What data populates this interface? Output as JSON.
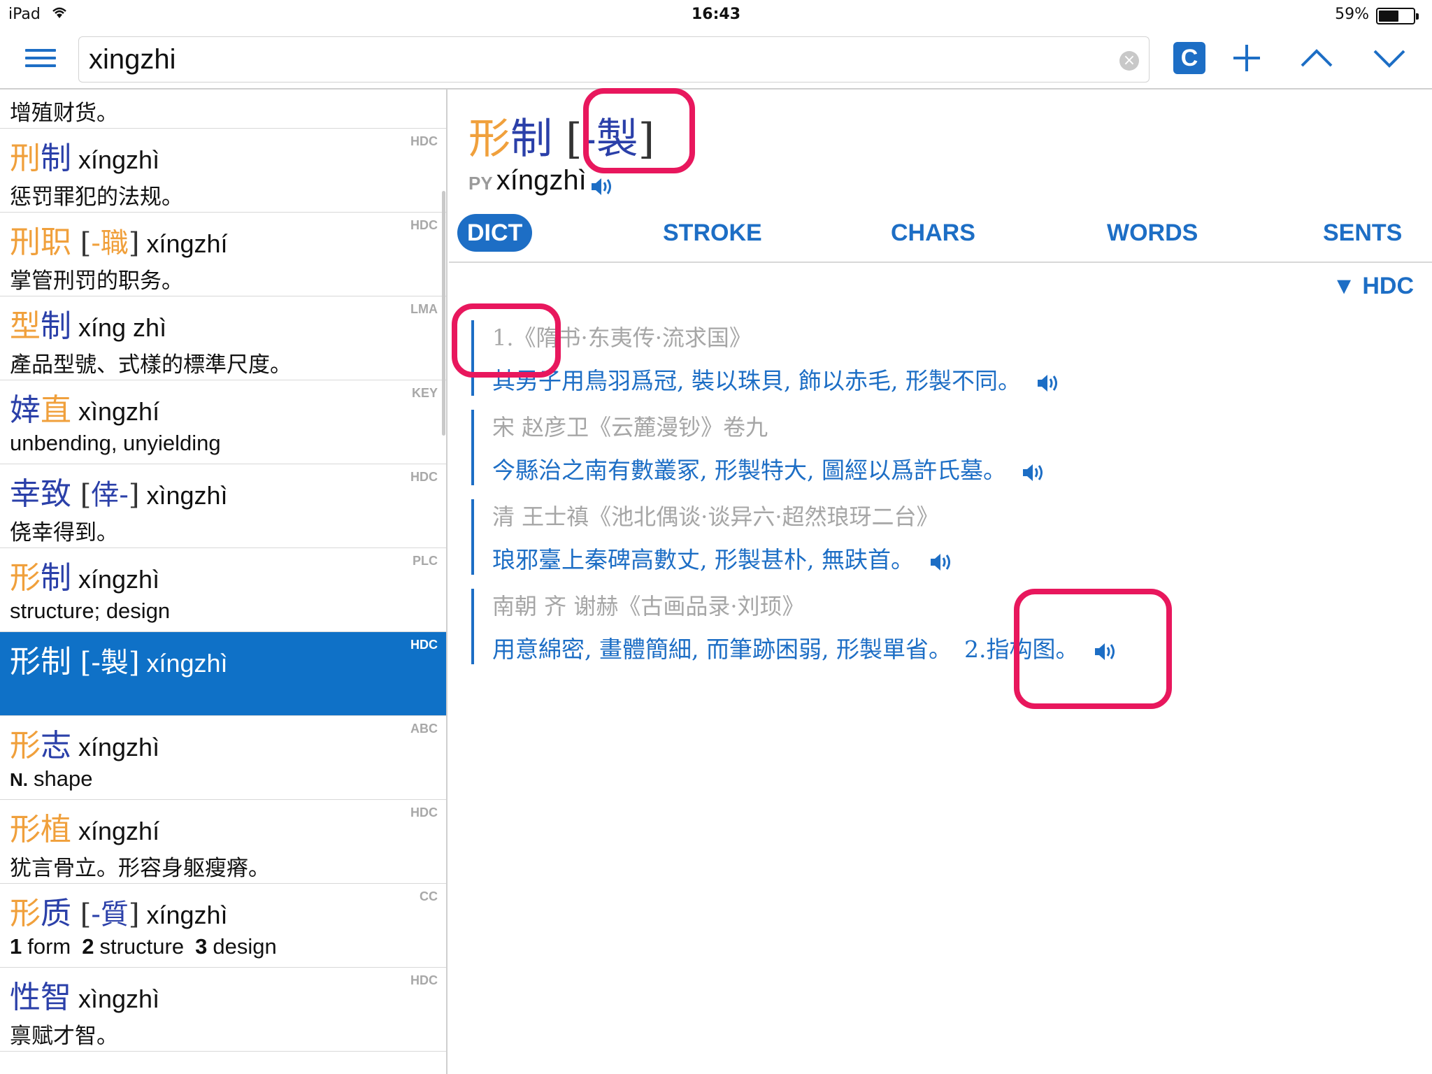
{
  "status_bar": {
    "device": "iPad",
    "time": "16:43",
    "battery": "59%",
    "battery_fraction": 0.59
  },
  "search": {
    "value": "xingzhi",
    "clear_glyph": "×",
    "c_label": "C"
  },
  "toolbar_icons": [
    "menu-icon",
    "clear-icon",
    "plus-icon",
    "chevron-up-icon",
    "chevron-down-icon"
  ],
  "list": {
    "top_partial_def": "增殖财货。",
    "entries": [
      {
        "hz": [
          "刑",
          "制"
        ],
        "tones": [
          2,
          4
        ],
        "trad": "",
        "py": "xíngzhì",
        "def": "惩罚罪犯的法规。",
        "src": "HDC",
        "cjk": true
      },
      {
        "hz": [
          "刑",
          "职"
        ],
        "tones": [
          2,
          2
        ],
        "trad": "-職",
        "py": "xíngzhí",
        "def": "掌管刑罚的职务。",
        "src": "HDC",
        "cjk": true
      },
      {
        "hz": [
          "型",
          "制"
        ],
        "tones": [
          2,
          4
        ],
        "trad": "",
        "py": "xíng zhì",
        "def": "產品型號、式樣的標準尺度。",
        "src": "LMA",
        "cjk": true
      },
      {
        "hz": [
          "婞",
          "直"
        ],
        "tones": [
          4,
          2
        ],
        "trad": "",
        "py": "xìngzhí",
        "def": "unbending, unyielding",
        "src": "KEY",
        "cjk": false
      },
      {
        "hz": [
          "幸",
          "致"
        ],
        "tones": [
          4,
          4
        ],
        "trad": "倖-",
        "py": "xìngzhì",
        "def": "侥幸得到。",
        "src": "HDC",
        "cjk": true
      },
      {
        "hz": [
          "形",
          "制"
        ],
        "tones": [
          2,
          4
        ],
        "trad": "",
        "py": "xíngzhì",
        "def": "structure; design",
        "src": "PLC",
        "cjk": false
      },
      {
        "hz": [
          "形",
          "制"
        ],
        "tones": [
          2,
          4
        ],
        "trad": "-製",
        "py": "xíngzhì",
        "def": "",
        "src": "HDC",
        "cjk": true,
        "selected": true
      },
      {
        "hz": [
          "形",
          "志"
        ],
        "tones": [
          2,
          4
        ],
        "trad": "",
        "py": "xíngzhì",
        "def_bold": "N.",
        "def": "shape",
        "src": "ABC",
        "cjk": false
      },
      {
        "hz": [
          "形",
          "植"
        ],
        "tones": [
          2,
          2
        ],
        "trad": "",
        "py": "xíngzhí",
        "def": "犹言骨立。形容身躯瘦瘠。",
        "src": "HDC",
        "cjk": true
      },
      {
        "hz": [
          "形",
          "质"
        ],
        "tones": [
          2,
          4
        ],
        "trad": "-質",
        "py": "xíngzhì",
        "def_numbered": [
          [
            "1",
            "form"
          ],
          [
            "2",
            "structure"
          ],
          [
            "3",
            "design"
          ]
        ],
        "def": "",
        "src": "CC",
        "cjk": false
      },
      {
        "hz": [
          "性",
          "智"
        ],
        "tones": [
          4,
          4
        ],
        "trad": "",
        "py": "xìngzhì",
        "def": "禀赋才智。",
        "src": "HDC",
        "cjk": true
      }
    ]
  },
  "detail": {
    "hz": [
      "形",
      "制"
    ],
    "trad": "-製",
    "py_label": "PY",
    "py": "xíngzhì",
    "tabs": [
      "DICT",
      "STROKE",
      "CHARS",
      "WORDS",
      "SENTS"
    ],
    "active_tab": "DICT",
    "source": "▼ HDC",
    "quotes": [
      {
        "src": "1.《隋书·东夷传·流求国》",
        "text": "其男子用鳥羽爲冠, 裝以珠貝, 飾以赤毛, 形製不同。",
        "link": ""
      },
      {
        "src": "宋 赵彦卫《云麓漫钞》卷九",
        "text": "今縣治之南有數叢冢, 形製特大, 圖經以爲許氏墓。",
        "link": ""
      },
      {
        "src": "清 王士禛《池北偶谈·谈异六·超然琅玡二台》",
        "text": "琅邪臺上秦碑高數丈, 形製甚朴, 無趺首。",
        "link": ""
      },
      {
        "src": "南朝 齐 谢赫《古画品录·刘顼》",
        "text": "用意綿密, 畫體簡細, 而筆跡困弱, 形製單省。",
        "link": "2.指构图。"
      }
    ]
  },
  "colors": {
    "accent": "#1d6ec5",
    "selected_row": "#0f71c7",
    "tone_orange": "#f0a03c",
    "tone_navy": "#2b40a9",
    "highlight": "#e8175d"
  }
}
